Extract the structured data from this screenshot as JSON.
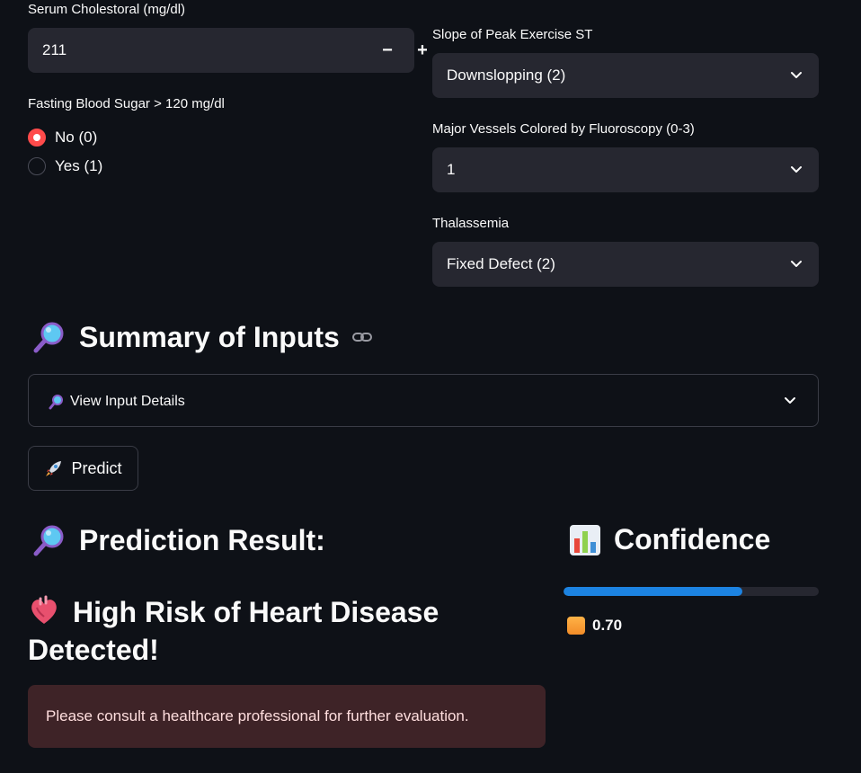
{
  "cholesterol": {
    "label": "Serum Cholestoral (mg/dl)",
    "value": "211",
    "minus": "−",
    "plus": "+"
  },
  "fbs": {
    "label": "Fasting Blood Sugar > 120 mg/dl",
    "options": [
      {
        "label": "No (0)",
        "selected": true
      },
      {
        "label": "Yes (1)",
        "selected": false
      }
    ]
  },
  "slope": {
    "label": "Slope of Peak Exercise ST",
    "value": "Downslopping (2)"
  },
  "vessels": {
    "label": "Major Vessels Colored by Fluoroscopy (0-3)",
    "value": "1"
  },
  "thal": {
    "label": "Thalassemia",
    "value": "Fixed Defect (2)"
  },
  "summary": {
    "title": "Summary of Inputs",
    "icon": "magnifier-icon",
    "link_icon": "link-icon",
    "expander_label": "View Input Details"
  },
  "predict": {
    "label": "Predict",
    "icon": "rocket-icon"
  },
  "result": {
    "title": "Prediction Result:",
    "headline": "High Risk of Heart Disease Detected!",
    "heart_icon": "anatomical-heart-icon",
    "alert": "Please consult a healthcare professional for further evaluation."
  },
  "confidence": {
    "title": "Confidence",
    "icon": "bar-chart-icon",
    "value": "0.70",
    "progress": 0.7
  },
  "colors": {
    "background": "#0e1117",
    "input_bg": "#262730",
    "accent_red": "#ff4b4b",
    "progress_blue": "#1c83e1",
    "alert_bg": "#3e2327"
  }
}
